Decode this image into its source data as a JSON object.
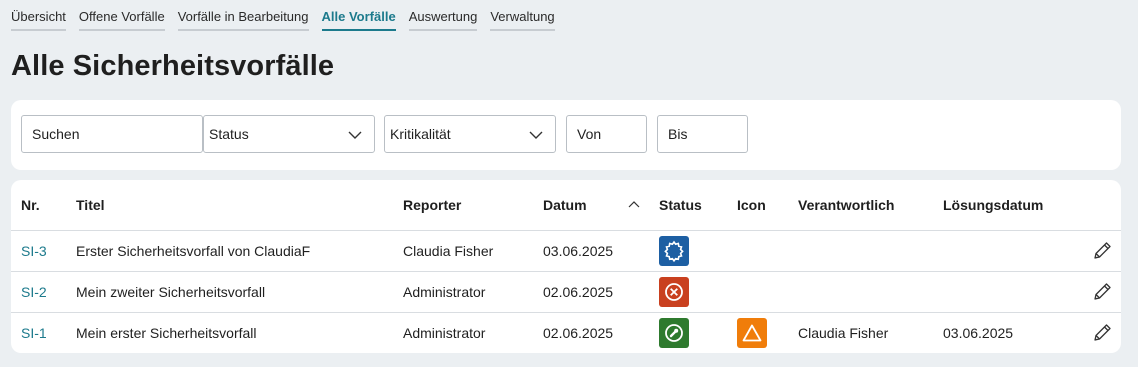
{
  "tabs": [
    {
      "label": "Übersicht",
      "active": false
    },
    {
      "label": "Offene Vorfälle",
      "active": false
    },
    {
      "label": "Vorfälle in Bearbeitung",
      "active": false
    },
    {
      "label": "Alle Vorfälle",
      "active": true
    },
    {
      "label": "Auswertung",
      "active": false
    },
    {
      "label": "Verwaltung",
      "active": false
    }
  ],
  "page_title": "Alle Sicherheitsvorfälle",
  "filters": {
    "search": "Suchen",
    "status": "Status",
    "criticality": "Kritikalität",
    "from": "Von",
    "to": "Bis"
  },
  "table": {
    "headers": {
      "nr": "Nr.",
      "titel": "Titel",
      "reporter": "Reporter",
      "datum": "Datum",
      "status": "Status",
      "icon": "Icon",
      "verantwortlich": "Verantwortlich",
      "loesungsdatum": "Lösungsdatum"
    },
    "sort": {
      "column": "datum",
      "direction": "ascending"
    },
    "rows": [
      {
        "nr": "SI-3",
        "titel": "Erster Sicherheitsvorfall von ClaudiaF",
        "reporter": "Claudia Fisher",
        "datum": "03.06.2025",
        "status_icon": "gear-status-icon",
        "status_color": "#1d5fa3",
        "icon": "",
        "icon_color": "",
        "verantwortlich": "",
        "loesungsdatum": ""
      },
      {
        "nr": "SI-2",
        "titel": "Mein zweiter Sicherheitsvorfall",
        "reporter": "Administrator",
        "datum": "02.06.2025",
        "status_icon": "x-circle-status-icon",
        "status_color": "#c9401f",
        "icon": "",
        "icon_color": "",
        "verantwortlich": "",
        "loesungsdatum": ""
      },
      {
        "nr": "SI-1",
        "titel": "Mein erster Sicherheitsvorfall",
        "reporter": "Administrator",
        "datum": "02.06.2025",
        "status_icon": "wrench-status-icon",
        "status_color": "#2e7a2e",
        "icon": "warning-triangle-icon",
        "icon_color": "#f07d0a",
        "verantwortlich": "Claudia Fisher",
        "loesungsdatum": "03.06.2025"
      }
    ]
  }
}
